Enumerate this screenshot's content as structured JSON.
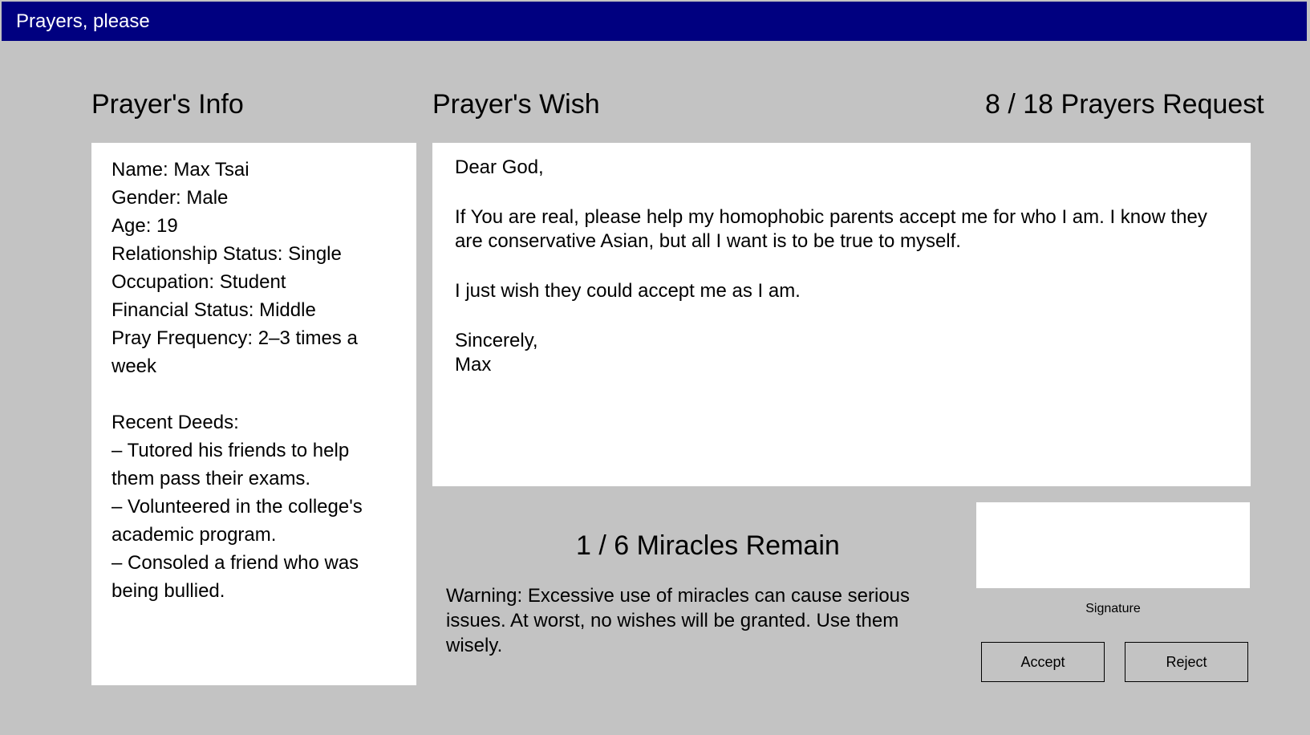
{
  "window": {
    "title": "Prayers, please"
  },
  "headings": {
    "info": "Prayer's Info",
    "wish": "Prayer's Wish",
    "counter": "8 / 18  Prayers Request"
  },
  "info": {
    "name": "Name: Max Tsai",
    "gender": "Gender: Male",
    "age": "Age: 19",
    "relationship": "Relationship Status: Single",
    "occupation": "Occupation: Student",
    "financial": "Financial Status: Middle",
    "pray_frequency": "Pray Frequency: 2–3 times a week",
    "deeds_label": "Recent Deeds:",
    "deeds": [
      "– Tutored his friends to help them pass their exams.",
      "– Volunteered in the college's academic program.",
      "– Consoled a friend who was being bullied."
    ]
  },
  "wish": {
    "greeting": "Dear God,",
    "body1": "If You are real, please help my homophobic parents accept me for who I am. I know they are conservative Asian, but all I want is to be true to myself.",
    "body2": "I just wish they could accept me as I am.",
    "closing": "Sincerely,",
    "signoff": "Max"
  },
  "miracles": {
    "counter": "1 / 6  Miracles Remain",
    "warning": "Warning: Excessive use of miracles can cause serious issues. At worst, no wishes will be granted. Use them wisely."
  },
  "signature": {
    "label": "Signature"
  },
  "actions": {
    "accept": "Accept",
    "reject": "Reject"
  },
  "colors": {
    "titlebar": "#000080",
    "background": "#c3c3c3",
    "panel": "#ffffff"
  }
}
